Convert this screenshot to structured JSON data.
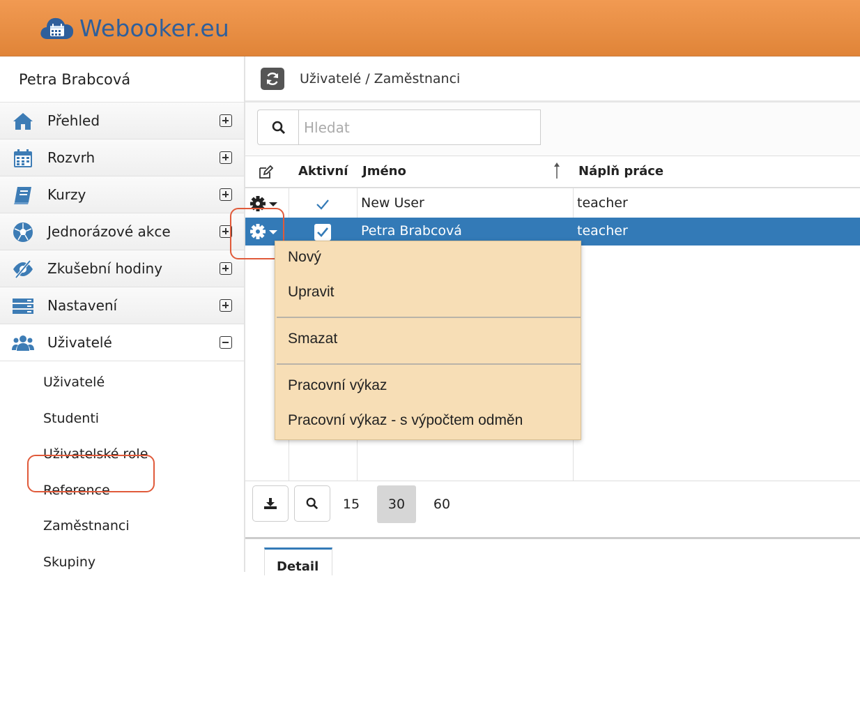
{
  "app": {
    "logo_text": "Webooker.eu"
  },
  "sidebar": {
    "user_name": "Petra Brabcová",
    "items": [
      {
        "label": "Přehled",
        "icon": "home-icon",
        "state": "collapsed"
      },
      {
        "label": "Rozvrh",
        "icon": "calendar-icon",
        "state": "collapsed"
      },
      {
        "label": "Kurzy",
        "icon": "book-icon",
        "state": "collapsed"
      },
      {
        "label": "Jednorázové akce",
        "icon": "soccer-ball-icon",
        "state": "collapsed"
      },
      {
        "label": "Zkušební hodiny",
        "icon": "eye-slash-icon",
        "state": "collapsed"
      },
      {
        "label": "Nastavení",
        "icon": "server-icon",
        "state": "collapsed"
      },
      {
        "label": "Uživatelé",
        "icon": "users-icon",
        "state": "expanded"
      }
    ],
    "subitems": [
      "Uživatelé",
      "Studenti",
      "Uživatelské role",
      "Reference",
      "Zaměstnanci",
      "Skupiny"
    ],
    "active_subitem": "Zaměstnanci"
  },
  "main": {
    "breadcrumb": "Uživatelé / Zaměstnanci",
    "search": {
      "placeholder": "Hledat",
      "value": ""
    },
    "table": {
      "columns": [
        "Aktivní",
        "Jméno",
        "Náplň práce"
      ],
      "rows": [
        {
          "active": true,
          "name": "New User",
          "job": "teacher",
          "selected": false
        },
        {
          "active": true,
          "name": "Petra Brabcová",
          "job": "teacher",
          "selected": true
        }
      ]
    },
    "page_sizes": [
      "15",
      "30",
      "60"
    ],
    "current_page_size": "30",
    "tabs": [
      "Detail"
    ]
  },
  "context_menu": {
    "items": [
      "Nový",
      "Upravit",
      "Smazat",
      "Pracovní výkaz",
      "Pracovní výkaz - s výpočtem odměn"
    ]
  },
  "colors": {
    "header": "#e8883f",
    "accent": "#337ab7",
    "menu_bg": "#f7deb6",
    "highlight": "#e05a3a"
  }
}
